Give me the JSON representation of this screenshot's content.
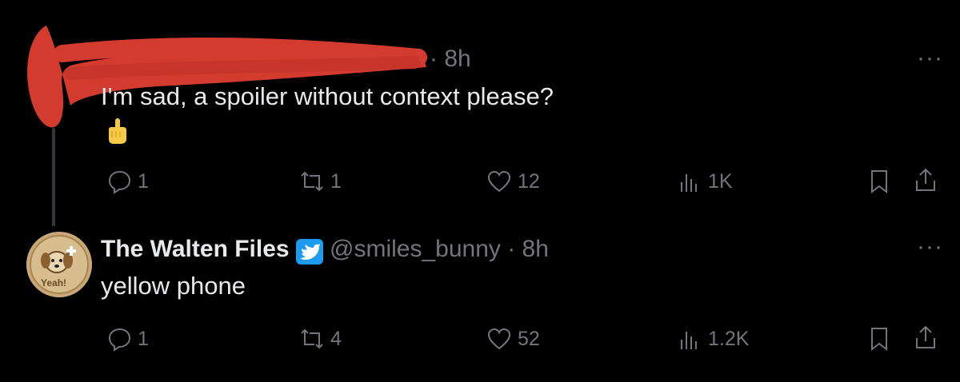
{
  "colors": {
    "background": "#000000",
    "text": "#e7e9ea",
    "muted": "#71767b",
    "redaction": "#d33b2f",
    "verified": "#1d9bf0"
  },
  "tweet1": {
    "time": "· 8h",
    "text": "I'm sad, a spoiler without context please?",
    "emoji": "point-up-emoji",
    "more": "···",
    "replies": "1",
    "reposts": "1",
    "likes": "12",
    "views": "1K"
  },
  "tweet2": {
    "name": "The Walten Files",
    "handle": "@smiles_bunny · 8h",
    "text": "yellow phone",
    "avatar_label": "Yeah!",
    "more": "···",
    "replies": "1",
    "reposts": "4",
    "likes": "52",
    "views": "1.2K"
  },
  "icons": [
    "reply-icon",
    "repost-icon",
    "like-icon",
    "views-icon",
    "bookmark-icon",
    "share-icon",
    "verified-badge-icon"
  ]
}
